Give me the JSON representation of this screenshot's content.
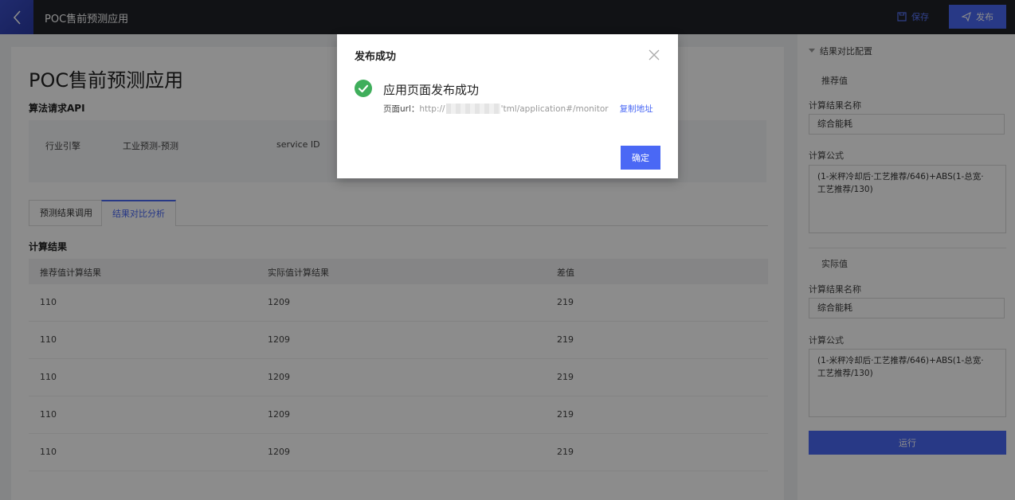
{
  "topbar": {
    "title": "POC售前预测应用",
    "save_label": "保存",
    "publish_label": "发布"
  },
  "main": {
    "page_title": "POC售前预测应用",
    "api_section_title": "算法请求API",
    "api_items": [
      "行业引擎",
      "工业预测-预测",
      "service ID"
    ],
    "tabs": [
      {
        "label": "预测结果调用",
        "active": false
      },
      {
        "label": "结果对比分析",
        "active": true
      }
    ],
    "calc_title": "计算结果",
    "table": {
      "headers": [
        "推荐值计算结果",
        "实际值计算结果",
        "差值"
      ],
      "rows": [
        [
          "110",
          "1209",
          "219"
        ],
        [
          "110",
          "1209",
          "219"
        ],
        [
          "110",
          "1209",
          "219"
        ],
        [
          "110",
          "1209",
          "219"
        ],
        [
          "110",
          "1209",
          "219"
        ]
      ]
    }
  },
  "right_panel": {
    "header": "结果对比配置",
    "recommended": {
      "title": "推荐值",
      "name_label": "计算结果名称",
      "name_value": "综合能耗",
      "formula_label": "计算公式",
      "formula_value": "(1-米秤冷却后·工艺推荐/646)+ABS(1-总宽·\n工艺推荐/130)"
    },
    "actual": {
      "title": "实际值",
      "name_label": "计算结果名称",
      "name_value": "综合能耗",
      "formula_label": "计算公式",
      "formula_value": "(1-米秤冷却后·工艺推荐/646)+ABS(1-总宽·\n工艺推荐/130)"
    },
    "run_label": "运行"
  },
  "modal": {
    "title": "发布成功",
    "success_text": "应用页面发布成功",
    "url_label": "页面url：",
    "url_prefix": "http://",
    "url_suffix": "'tml/application#/monitor",
    "copy_label": "复制地址",
    "ok_label": "确定"
  },
  "colors": {
    "accent": "#4a68f5",
    "success": "#3fae5b",
    "topbar": "#1f2127"
  }
}
